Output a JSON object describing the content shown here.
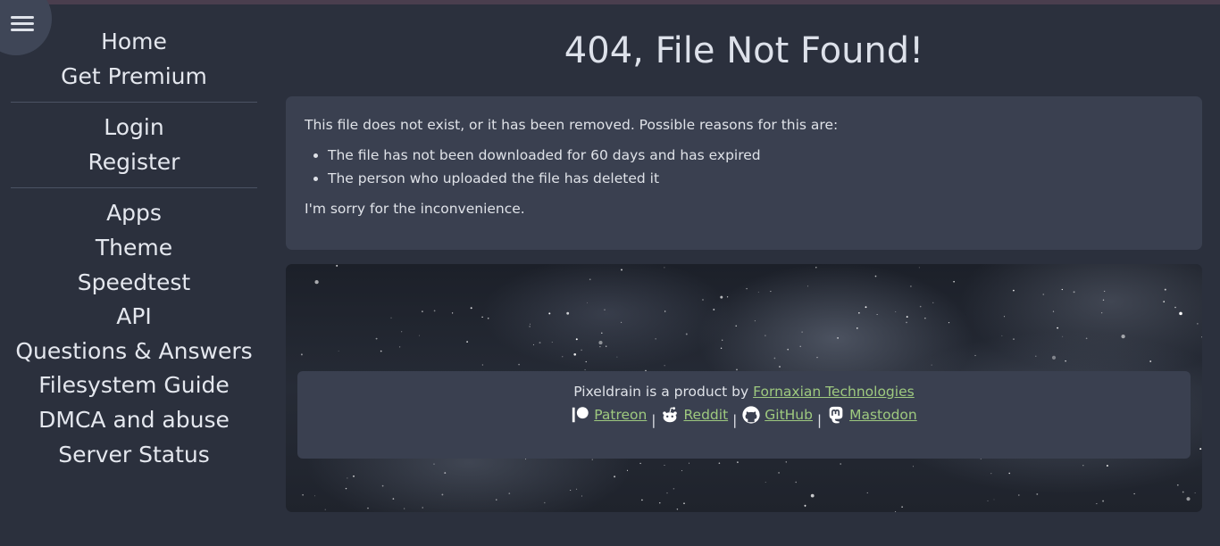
{
  "sidebar": {
    "toggle_icon": "hamburger-menu-icon",
    "group1": [
      "Home",
      "Get Premium"
    ],
    "group2": [
      "Login",
      "Register"
    ],
    "group3": [
      "Apps",
      "Theme",
      "Speedtest",
      "API",
      "Questions & Answers",
      "Filesystem Guide",
      "DMCA and abuse",
      "Server Status"
    ]
  },
  "main": {
    "title": "404, File Not Found!",
    "intro": "This file does not exist, or it has been removed. Possible reasons for this are:",
    "reasons": [
      "The file has not been downloaded for 60 days and has expired",
      "The person who uploaded the file has deleted it"
    ],
    "apology": "I'm sorry for the inconvenience."
  },
  "footer": {
    "product_text": "Pixeldrain is a product by ",
    "company_link": "Fornaxian Technologies",
    "separator": "|",
    "links": [
      {
        "label": " Patreon",
        "icon": "patreon-icon"
      },
      {
        "label": " Reddit",
        "icon": "reddit-icon"
      },
      {
        "label": " GitHub",
        "icon": "github-icon"
      },
      {
        "label": " Mastodon",
        "icon": "mastodon-icon"
      }
    ],
    "link_color": "#9ec97f"
  }
}
